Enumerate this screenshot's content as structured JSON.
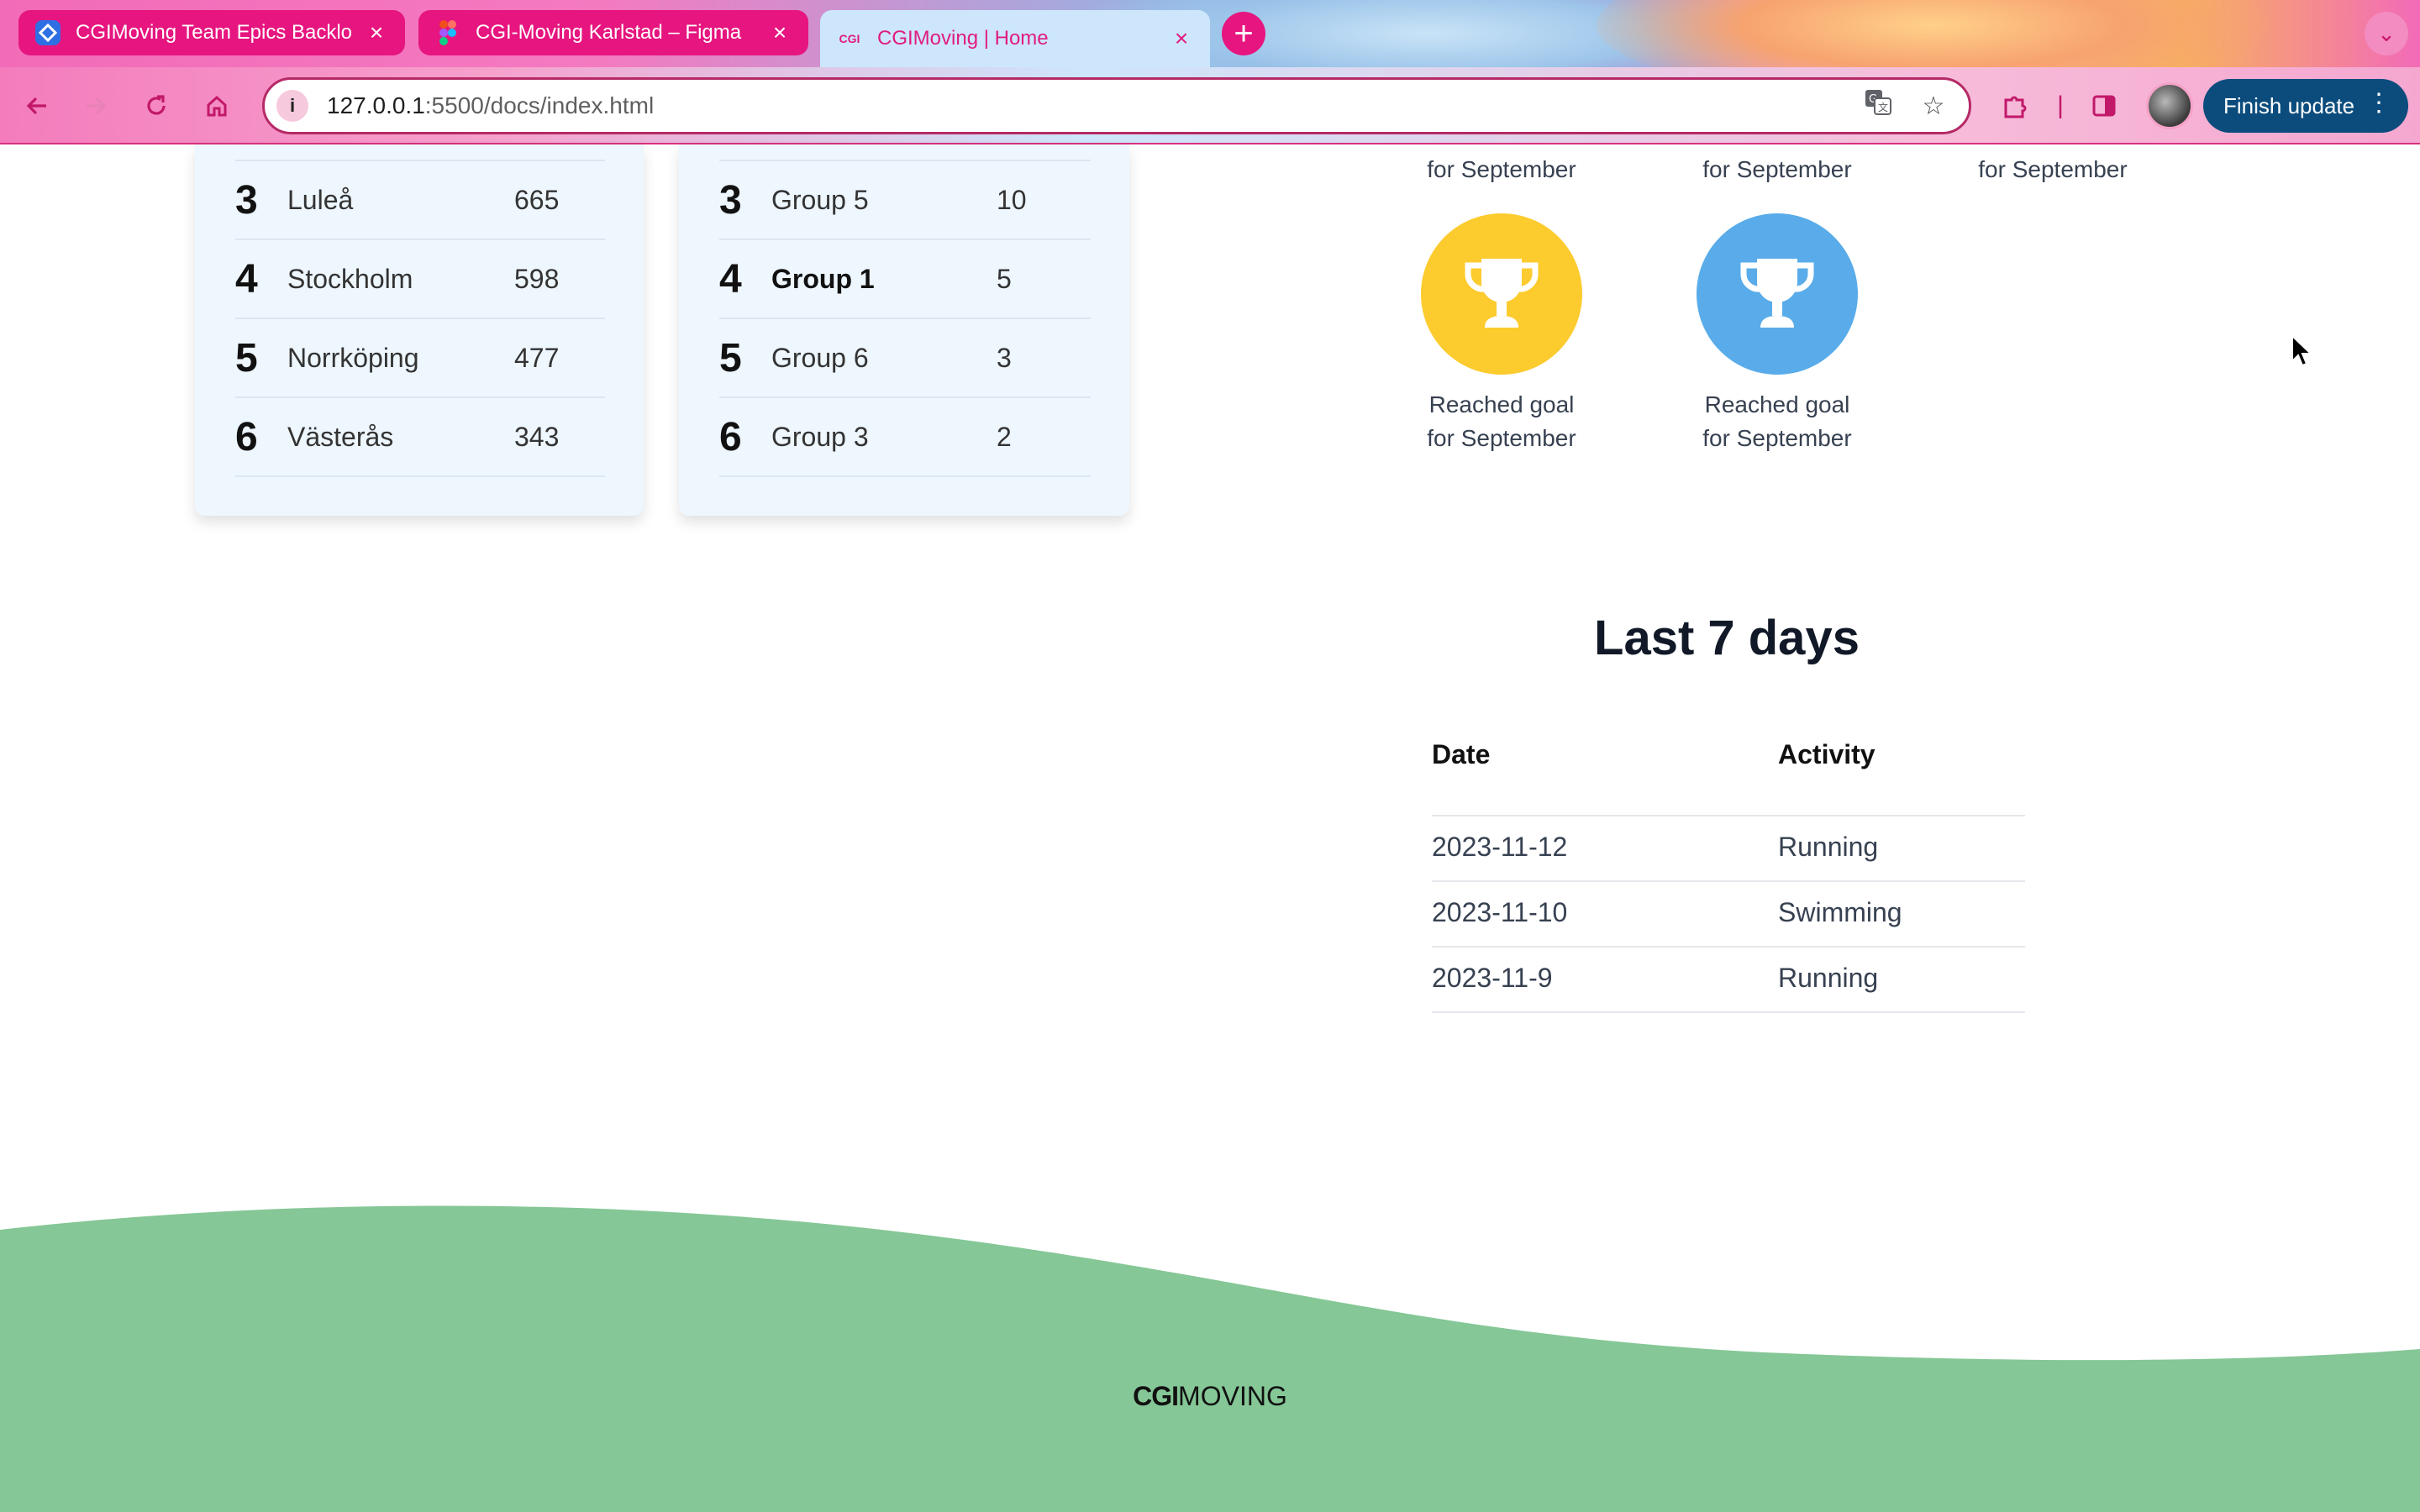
{
  "browser": {
    "tabs": [
      {
        "title": "CGIMoving Team Epics Backlo",
        "icon": "jira-icon",
        "active": false
      },
      {
        "title": "CGI-Moving Karlstad – Figma",
        "icon": "figma-icon",
        "active": false
      },
      {
        "title": "CGIMoving | Home",
        "icon": "cgi-favicon",
        "favicon_text": "CGI",
        "active": true
      }
    ],
    "close_glyph": "×",
    "url_host": "127.0.0.1",
    "url_path": ":5500/docs/index.html",
    "finish_update_label": "Finish update",
    "accent_color": "#e6157f",
    "button_color": "#0b4c7d"
  },
  "cities_board": {
    "rows": [
      {
        "rank": "3",
        "name": "Luleå",
        "score": "665"
      },
      {
        "rank": "4",
        "name": "Stockholm",
        "score": "598"
      },
      {
        "rank": "5",
        "name": "Norrköping",
        "score": "477"
      },
      {
        "rank": "6",
        "name": "Västerås",
        "score": "343"
      }
    ]
  },
  "groups_board": {
    "rows": [
      {
        "rank": "3",
        "name": "Group 5",
        "score": "10",
        "highlight": false
      },
      {
        "rank": "4",
        "name": "Group 1",
        "score": "5",
        "highlight": true
      },
      {
        "rank": "5",
        "name": "Group 6",
        "score": "3",
        "highlight": false
      },
      {
        "rank": "6",
        "name": "Group 3",
        "score": "2",
        "highlight": false
      }
    ]
  },
  "badges": {
    "partial_captions": [
      "for September",
      "for September",
      "for September"
    ],
    "items": [
      {
        "caption_line1": "Reached goal",
        "caption_line2": "for September",
        "color": "#fccb2e",
        "icon": "trophy-icon"
      },
      {
        "caption_line1": "Reached goal",
        "caption_line2": "for September",
        "color": "#59ace9",
        "icon": "trophy-icon"
      }
    ]
  },
  "recent": {
    "title": "Last 7 days",
    "headers": [
      "Date",
      "Activity"
    ],
    "rows": [
      {
        "date": "2023-11-12",
        "activity": "Running"
      },
      {
        "date": "2023-11-10",
        "activity": "Swimming"
      },
      {
        "date": "2023-11-9",
        "activity": "Running"
      }
    ]
  },
  "footer": {
    "logo_strong": "CGI",
    "logo_rest": "MOVING",
    "color": "#85c796"
  }
}
